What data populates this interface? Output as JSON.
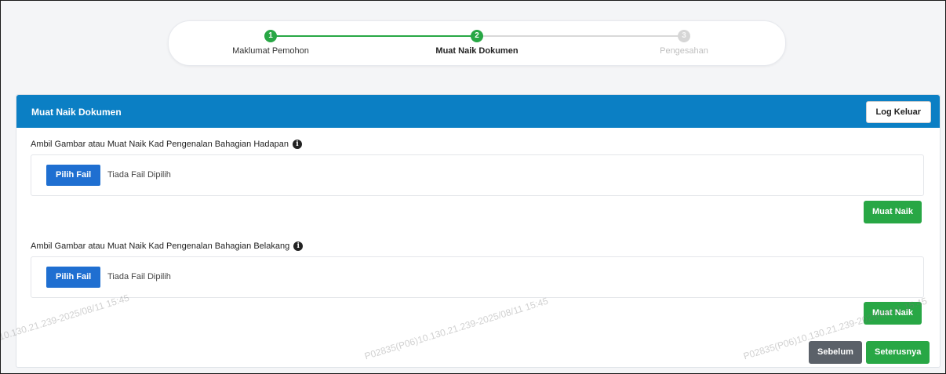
{
  "stepper": {
    "steps": [
      {
        "number": "1",
        "label": "Maklumat Pemohon",
        "state": "done"
      },
      {
        "number": "2",
        "label": "Muat Naik Dokumen",
        "state": "active"
      },
      {
        "number": "3",
        "label": "Pengesahan",
        "state": "todo"
      }
    ]
  },
  "card": {
    "title": "Muat Naik Dokumen",
    "logout_label": "Log Keluar",
    "sections": [
      {
        "label": "Ambil Gambar atau Muat Naik Kad Pengenalan Bahagian Hadapan",
        "choose_label": "Pilih Fail",
        "status": "Tiada Fail Dipilih",
        "upload_label": "Muat Naik"
      },
      {
        "label": "Ambil Gambar atau Muat Naik Kad Pengenalan Bahagian Belakang",
        "choose_label": "Pilih Fail",
        "status": "Tiada Fail Dipilih",
        "upload_label": "Muat Naik"
      }
    ],
    "prev_label": "Sebelum",
    "next_label": "Seterusnya"
  },
  "watermark": {
    "text": "P02835(P06)10.130.21.239-2025/08/11 15:45"
  },
  "colors": {
    "header": "#0b7fc4",
    "success": "#28a745",
    "primary": "#1f6fd1",
    "secondary": "#5b6169"
  },
  "icons": {
    "info": "info-icon"
  }
}
